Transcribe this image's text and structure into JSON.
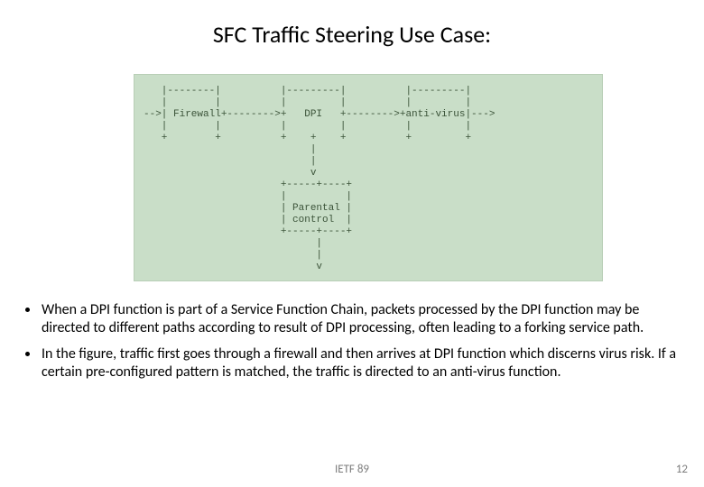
{
  "title": "SFC Traffic Steering Use Case:",
  "diagram_lines": [
    "   |--------|          |---------|          |---------|",
    "   |        |          |         |          |         |",
    "-->| Firewall+-------->+   DPI   +-------->+anti-virus|--->",
    "   |        |          |         |          |         |",
    "   +        +          +    +    +          +         +",
    "                            |",
    "                            |",
    "                            v",
    "                       +-----+----+",
    "                       |          |",
    "                       | Parental |",
    "                       | control  |",
    "                       +-----+----+",
    "                             |",
    "                             |",
    "                             v"
  ],
  "bullets": [
    "When a DPI function is part of a Service Function Chain, packets processed by the DPI function may be directed to different paths according to result of DPI processing,  often leading to a forking service path.",
    "In the figure, traffic first goes through a firewall and then arrives at DPI function which discerns virus risk. If a certain pre-configured pattern is matched, the traffic is directed to an anti-virus function."
  ],
  "footer_center": "IETF 89",
  "footer_right": "12"
}
